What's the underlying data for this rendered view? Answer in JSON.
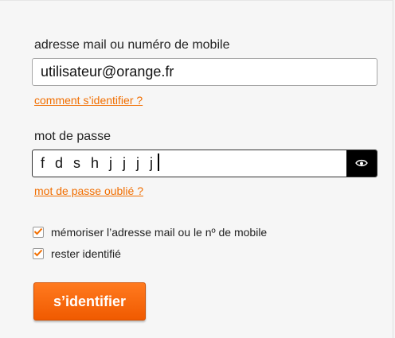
{
  "login_form": {
    "email_label": "adresse mail ou numéro de mobile",
    "email_value": "utilisateur@orange.fr",
    "identify_help_link": "comment s’identifier ?",
    "password_label": "mot de passe",
    "password_value": "f d s h j j j j",
    "show_password_icon": "eye-icon",
    "forgot_password_link": "mot de passe oublié ?",
    "remember_checkbox": {
      "label": "mémoriser l’adresse mail ou le nº de mobile",
      "checked": true
    },
    "stay_logged_checkbox": {
      "label": "rester identifié",
      "checked": true
    },
    "submit_label": "s’identifier"
  },
  "colors": {
    "accent": "#f16e00",
    "button_top": "#ff7a1f",
    "button_bottom": "#f05a00",
    "background": "#f6f6f6"
  }
}
